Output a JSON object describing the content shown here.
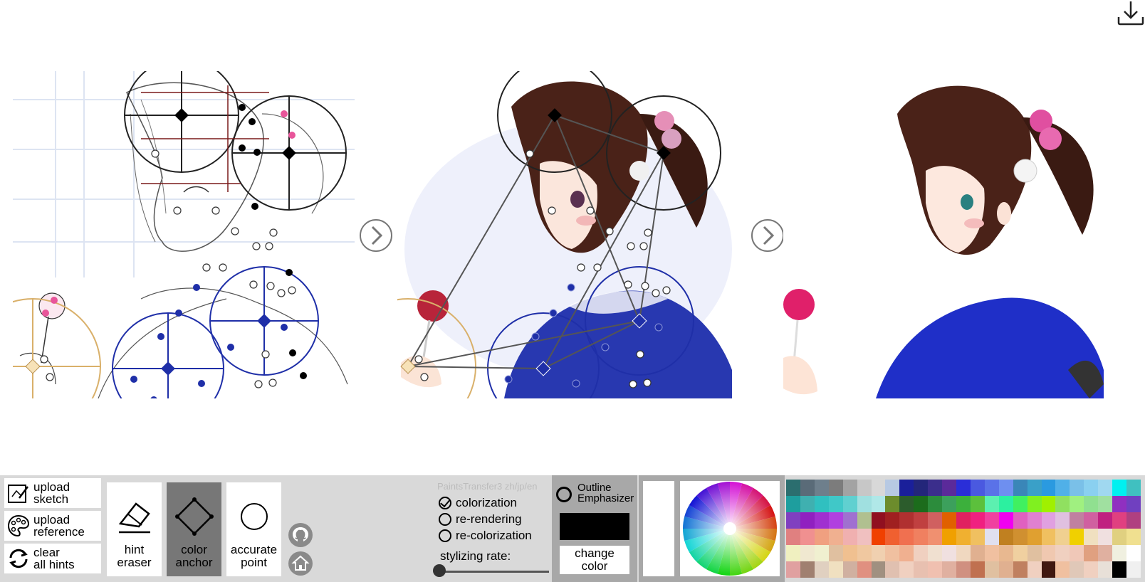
{
  "toolbar": {
    "upload_sketch": "upload\nsketch",
    "upload_reference": "upload\nreference",
    "clear_hints": "clear\nall hints",
    "hint_eraser": "hint\neraser",
    "color_anchor": "color\nanchor",
    "accurate_point": "accurate\npoint",
    "brand": "PaintsTransfer3 zh/jp/en",
    "modes": [
      "colorization",
      "re-rendering",
      "re-colorization"
    ],
    "selected_mode": "colorization",
    "stylizing_rate_label": "stylizing rate:",
    "stylizing_rate": 0,
    "outline_label": "Outline\nEmphasizer",
    "current_color": "#000000",
    "change_color": "change\ncolor"
  },
  "icons": {
    "download": "download-icon",
    "next_arrow": "chevron-right-circle-icon",
    "github": "github-icon",
    "home": "home-icon"
  },
  "colors": {
    "toolbar_bg": "#d9d9d9",
    "active_tool": "#777777",
    "hint_blue": "#1f2fa8",
    "hint_gold": "#d9b06a",
    "hint_pink": "#e8559a"
  },
  "palette": [
    [
      "#2b6e6f",
      "#5a6b78",
      "#6e7f8c",
      "#7c7c7c",
      "#a3a3a3",
      "#c7c7c7",
      "#d8d8d8",
      "#b7c9e3",
      "#1a1f9a",
      "#23267a",
      "#3b2e8c",
      "#5b2a9a",
      "#2a2ed8",
      "#4a59e0",
      "#5a72e8",
      "#6e8ff0",
      "#3a86b8",
      "#3aa0c8",
      "#2a9ae0",
      "#50b0e8",
      "#7ac0e8",
      "#8ad0f0",
      "#a0d8f0",
      "#00f0f0",
      "#40c0c0"
    ],
    [
      "#1e9e9e",
      "#3fb0b0",
      "#30c0c0",
      "#40c8c8",
      "#60d0d0",
      "#a0e0e0",
      "#b0e8e8",
      "#6c8c2c",
      "#2c5c2c",
      "#1c6c1c",
      "#2c8c3c",
      "#3ca05c",
      "#3cb03c",
      "#5cc03c",
      "#5cf0b0",
      "#2cf0a0",
      "#40f060",
      "#80f020",
      "#a0f000",
      "#90e060",
      "#a0f080",
      "#90e090",
      "#a0e0a0",
      "#9030c0",
      "#7040c0"
    ],
    [
      "#8040c0",
      "#9020c0",
      "#a030d0",
      "#b040e0",
      "#a070d0",
      "#b0c090",
      "#901020",
      "#a02020",
      "#b03030",
      "#c04040",
      "#d06060",
      "#e06000",
      "#e02060",
      "#f02080",
      "#f040a0",
      "#f000f0",
      "#e060c0",
      "#e080d0",
      "#e0a0e0",
      "#e0c0e0",
      "#c080a0",
      "#d060a0",
      "#c02080",
      "#e04080",
      "#b04080"
    ],
    [
      "#e08080",
      "#f09090",
      "#f0a080",
      "#f0b090",
      "#f0b0b0",
      "#f0c0c0",
      "#f04000",
      "#f06030",
      "#f07050",
      "#f08060",
      "#f09070",
      "#f0a000",
      "#f0b030",
      "#f0c060",
      "#e0e0f0",
      "#c08020",
      "#d09030",
      "#e0a030",
      "#f0c060",
      "#f0d090",
      "#f0d000",
      "#f0e0c0",
      "#f0e0e0",
      "#e0d080",
      "#f0e090"
    ],
    [
      "#f0f0c0",
      "#f0e8d0",
      "#f0f0d0",
      "#e0c0a0",
      "#f0c090",
      "#f0c8a0",
      "#f0d0b0",
      "#f0c0a0",
      "#f0b090",
      "#f0d0c0",
      "#f0e0d0",
      "#f0e0e0",
      "#f0d8c0",
      "#e0b090",
      "#f0c0a0",
      "#e8b890",
      "#f0d0a0",
      "#e0c0a0",
      "#f0c8b0",
      "#f0d0c0",
      "#f0c8b8",
      "#e0a080",
      "#e0b0a0",
      "#f0f0e0",
      "#ffffff"
    ],
    [
      "#e0a0a0",
      "#a08070",
      "#e0d0c0",
      "#f0e0c0",
      "#d0b0a0",
      "#e09080",
      "#a09080",
      "#e0c0b0",
      "#f0d0c0",
      "#e8c0b0",
      "#f0c0b0",
      "#e0b0a0",
      "#d09080",
      "#c07050",
      "#e0c0a0",
      "#e0b090",
      "#c08060",
      "#f0d0c0",
      "#401810",
      "#f0c0a0",
      "#e0c8b8",
      "#f0d0c0",
      "#e8e0d8",
      "#000000",
      "#f0f0f0"
    ]
  ]
}
